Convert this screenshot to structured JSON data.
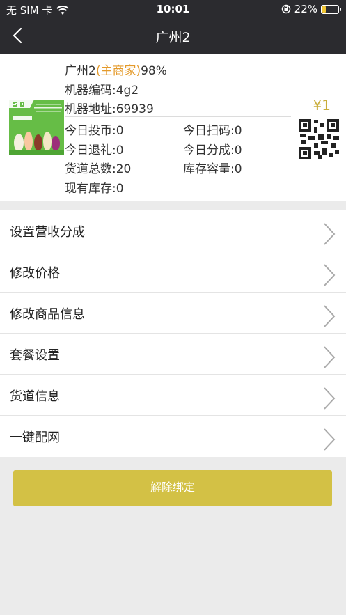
{
  "status_bar": {
    "carrier": "无 SIM 卡",
    "time": "10:01",
    "battery": "22%",
    "battery_level": 0.22
  },
  "nav": {
    "title": "广州2"
  },
  "machine": {
    "name": "广州2",
    "role": "(主商家)",
    "percent": "98%",
    "code_line": "机器编码:4g2",
    "address_line": "机器地址:69939",
    "price": "¥1",
    "stats": {
      "coins_today": "今日投币:0",
      "scans_today": "今日扫码:0",
      "refunds_today": "今日退礼:0",
      "share_today": "今日分成:0",
      "total_lanes": "货道总数:20",
      "capacity": "库存容量:0",
      "current_stock": "现有库存:0"
    },
    "thumbnail_icon": "product-poster-image",
    "qr_icon": "qr-code-icon"
  },
  "menu": [
    {
      "label": "设置营收分成",
      "name": "menu-revenue-share"
    },
    {
      "label": "修改价格",
      "name": "menu-edit-price"
    },
    {
      "label": "修改商品信息",
      "name": "menu-edit-product"
    },
    {
      "label": "套餐设置",
      "name": "menu-package-settings"
    },
    {
      "label": "货道信息",
      "name": "menu-lane-info"
    },
    {
      "label": "一键配网",
      "name": "menu-network-setup"
    }
  ],
  "actions": {
    "unbind_label": "解除绑定"
  },
  "colors": {
    "header_bg": "#2b2b2f",
    "accent_gold": "#d3c145",
    "role_orange": "#e49a2a",
    "price_gold": "#c9ad3a"
  }
}
